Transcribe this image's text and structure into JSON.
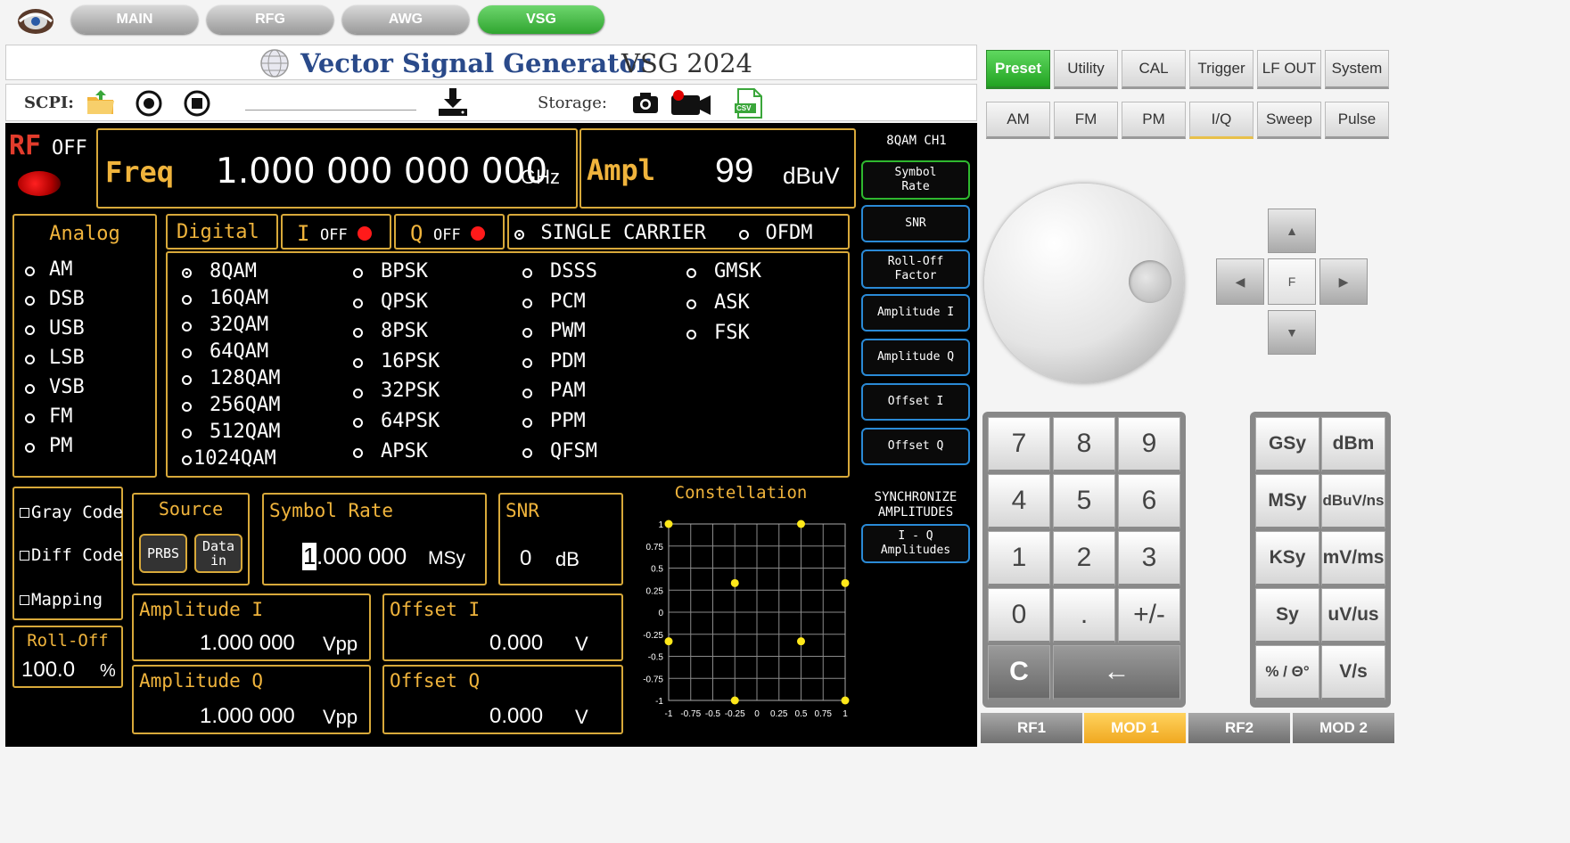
{
  "top_tabs": [
    {
      "label": "MAIN",
      "active": false
    },
    {
      "label": "RFG",
      "active": false
    },
    {
      "label": "AWG",
      "active": false
    },
    {
      "label": "VSG",
      "active": true
    }
  ],
  "header": {
    "title": "Vector Signal Generator",
    "model": "VSG 2024"
  },
  "toolbar": {
    "scpi_label": "SCPI:",
    "storage_label": "Storage:",
    "csv_label": "CSV"
  },
  "rf": {
    "label": "RF",
    "state": "OFF"
  },
  "freq": {
    "label": "Freq",
    "value": "1.000 000 000 000",
    "unit": "GHz"
  },
  "ampl": {
    "label": "Ampl",
    "value": "99",
    "unit": "dBuV"
  },
  "analog": {
    "title": "Analog",
    "items": [
      "AM",
      "DSB",
      "USB",
      "LSB",
      "VSB",
      "FM",
      "PM"
    ]
  },
  "digital": {
    "title": "Digital",
    "i_label": "I",
    "i_state": "OFF",
    "q_label": "Q",
    "q_state": "OFF",
    "carrier_single": "SINGLE CARRIER",
    "carrier_ofdm": "OFDM",
    "col1": [
      "8QAM",
      "16QAM",
      "32QAM",
      "64QAM",
      "128QAM",
      "256QAM",
      "512QAM",
      "1024QAM"
    ],
    "col2": [
      "BPSK",
      "QPSK",
      "8PSK",
      "16PSK",
      "32PSK",
      "64PSK",
      "APSK"
    ],
    "col3": [
      "DSSS",
      "PCM",
      "PWM",
      "PDM",
      "PAM",
      "PPM",
      "QFSM"
    ],
    "col4": [
      "GMSK",
      "ASK",
      "FSK"
    ],
    "selected": "8QAM"
  },
  "options": {
    "gray_code": "Gray Code",
    "diff_code": "Diff Code",
    "mapping": "Mapping"
  },
  "rolloff": {
    "label": "Roll-Off",
    "value": "100.0",
    "unit": "%"
  },
  "source": {
    "label": "Source",
    "prbs": "PRBS",
    "data_in_1": "Data",
    "data_in_2": "in"
  },
  "symbol_rate": {
    "label": "Symbol Rate",
    "cursor_digit": "1",
    "value_rest": ".000 000",
    "unit": "MSy"
  },
  "snr": {
    "label": "SNR",
    "value": "0",
    "unit": "dB"
  },
  "amp_i": {
    "label": "Amplitude I",
    "value": "1.000 000",
    "unit": "Vpp"
  },
  "amp_q": {
    "label": "Amplitude Q",
    "value": "1.000 000",
    "unit": "Vpp"
  },
  "off_i": {
    "label": "Offset I",
    "value": "0.000",
    "unit": "V"
  },
  "off_q": {
    "label": "Offset Q",
    "value": "0.000",
    "unit": "V"
  },
  "side_panel": {
    "header": "8QAM CH1",
    "btn_symbol_1": "Symbol",
    "btn_symbol_2": "Rate",
    "btn_snr": "SNR",
    "btn_rolloff_1": "Roll-Off",
    "btn_rolloff_2": "Factor",
    "btn_amp_i": "Amplitude I",
    "btn_amp_q": "Amplitude Q",
    "btn_off_i": "Offset I",
    "btn_off_q": "Offset Q",
    "sync_1": "SYNCHRONIZE",
    "sync_2": "AMPLITUDES",
    "btn_iq_1": "I - Q",
    "btn_iq_2": "Amplitudes"
  },
  "chart_data": {
    "type": "scatter",
    "title": "Constellation",
    "xlim": [
      -1,
      1
    ],
    "ylim": [
      -1,
      1
    ],
    "grid": true,
    "xticks": [
      "-1",
      "-0.75",
      "-0.5",
      "-0.25",
      "0",
      "0.25",
      "0.5",
      "0.75",
      "1"
    ],
    "yticks": [
      "1",
      "0.75",
      "0.5",
      "0.25",
      "0",
      "-0.25",
      "-0.5",
      "-0.75",
      "-1"
    ],
    "tick_values": [
      -1,
      -0.75,
      -0.5,
      -0.25,
      0,
      0.25,
      0.5,
      0.75,
      1
    ],
    "points": [
      {
        "x": -1,
        "y": 1
      },
      {
        "x": 0.5,
        "y": 1
      },
      {
        "x": -0.25,
        "y": 0.33
      },
      {
        "x": 1,
        "y": 0.33
      },
      {
        "x": -1,
        "y": -0.33
      },
      {
        "x": 0.5,
        "y": -0.33
      },
      {
        "x": -0.25,
        "y": -1
      },
      {
        "x": 1,
        "y": -1
      }
    ],
    "point_color": "#ffe81a"
  },
  "right_tabs_row1": [
    {
      "label": "Preset",
      "style": "green"
    },
    {
      "label": "Utility",
      "style": ""
    },
    {
      "label": "CAL",
      "style": ""
    },
    {
      "label": "Trigger",
      "style": ""
    },
    {
      "label": "LF OUT",
      "style": ""
    },
    {
      "label": "System",
      "style": ""
    }
  ],
  "right_tabs_row2": [
    {
      "label": "AM",
      "style": ""
    },
    {
      "label": "FM",
      "style": ""
    },
    {
      "label": "PM",
      "style": ""
    },
    {
      "label": "I/Q",
      "style": "iq"
    },
    {
      "label": "Sweep",
      "style": ""
    },
    {
      "label": "Pulse",
      "style": ""
    }
  ],
  "dpad": {
    "center": "F"
  },
  "keypad": [
    "7",
    "8",
    "9",
    "4",
    "5",
    "6",
    "1",
    "2",
    "3",
    "0",
    ".",
    "+/-"
  ],
  "keypad_clear": "C",
  "keypad_back": "←",
  "units": [
    "GSy",
    "dBm",
    "MSy",
    "dBuV/ns",
    "KSy",
    "mV/ms",
    "Sy",
    "uV/us",
    "% / Θ°",
    "V/s"
  ],
  "bottom_tabs": [
    {
      "label": "RF1",
      "active": false
    },
    {
      "label": "MOD 1",
      "active": true
    },
    {
      "label": "RF2",
      "active": false
    },
    {
      "label": "MOD 2",
      "active": false
    }
  ],
  "colors": {
    "accent": "#f0b43c",
    "blue_border": "#2a8ad6",
    "preset_green": "#2fa52f",
    "mod_tab": "#f0a820",
    "rf_led": "#e00000"
  }
}
